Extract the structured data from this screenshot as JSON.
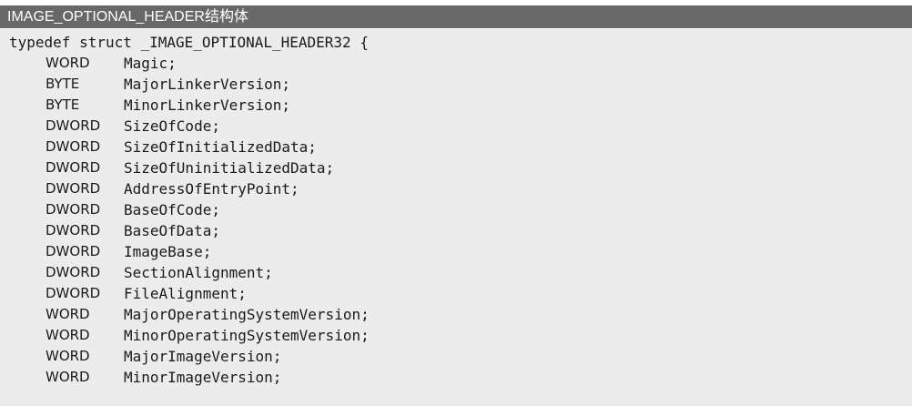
{
  "title": "IMAGE_OPTIONAL_HEADER结构体",
  "code": {
    "header": "typedef struct _IMAGE_OPTIONAL_HEADER32 {",
    "members": [
      {
        "type": "WORD",
        "name": "Magic;"
      },
      {
        "type": "BYTE",
        "name": "MajorLinkerVersion;"
      },
      {
        "type": "BYTE",
        "name": "MinorLinkerVersion;"
      },
      {
        "type": "DWORD",
        "name": "SizeOfCode;"
      },
      {
        "type": "DWORD",
        "name": "SizeOfInitializedData;"
      },
      {
        "type": "DWORD",
        "name": "SizeOfUninitializedData;"
      },
      {
        "type": "DWORD",
        "name": "AddressOfEntryPoint;"
      },
      {
        "type": "DWORD",
        "name": "BaseOfCode;"
      },
      {
        "type": "DWORD",
        "name": "BaseOfData;"
      },
      {
        "type": "DWORD",
        "name": "ImageBase;"
      },
      {
        "type": "DWORD",
        "name": "SectionAlignment;"
      },
      {
        "type": "DWORD",
        "name": "FileAlignment;"
      },
      {
        "type": "WORD",
        "name": "MajorOperatingSystemVersion;"
      },
      {
        "type": "WORD",
        "name": "MinorOperatingSystemVersion;"
      },
      {
        "type": "WORD",
        "name": "MajorImageVersion;"
      },
      {
        "type": "WORD",
        "name": "MinorImageVersion;"
      }
    ]
  }
}
